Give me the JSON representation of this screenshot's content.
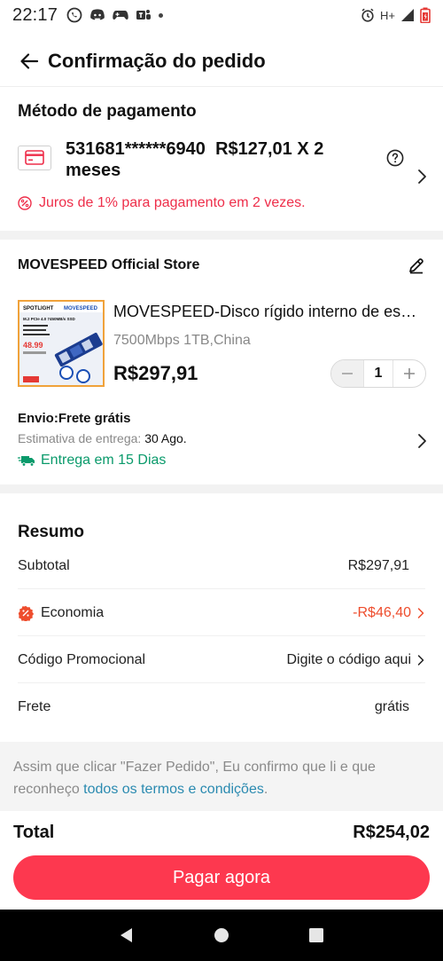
{
  "status_bar": {
    "time": "22:17",
    "network": "H+",
    "left_icons": [
      "whatsapp-icon",
      "discord-icon",
      "game-controller-icon",
      "teams-icon"
    ],
    "right_icons": [
      "alarm-icon",
      "signal-icon",
      "battery-icon"
    ]
  },
  "header": {
    "title": "Confirmação do pedido",
    "back_icon": "arrow-left-icon"
  },
  "payment": {
    "section_title": "Método de pagamento",
    "card_masked": "531681******6940",
    "installment": "R$127,01 X 2 meses",
    "interest_note": "Juros de 1% para pagamento em 2 vezes."
  },
  "store": {
    "name": "MOVESPEED Official Store"
  },
  "product": {
    "title": "MOVESPEED-Disco rígido interno de es…",
    "variant": "7500Mbps 1TB,China",
    "price": "R$297,91",
    "quantity": "1",
    "thumb_brand_left": "SPOTLIGHT",
    "thumb_brand_right": "MOVESPEED",
    "thumb_heading": "M.2 PCIe 4.0 7450MB/s SSD",
    "thumb_price": "48.99"
  },
  "shipping": {
    "label": "Envio:Frete grátis",
    "estimate_label": "Estimativa de entrega:",
    "estimate_date": "30 Ago.",
    "delivery_days": "Entrega em 15 Dias"
  },
  "summary": {
    "title": "Resumo",
    "subtotal_label": "Subtotal",
    "subtotal_value": "R$297,91",
    "economy_label": "Economia",
    "economy_value": "-R$46,40",
    "promo_label": "Código Promocional",
    "promo_value": "Digite o código aqui",
    "shipping_label": "Frete",
    "shipping_value": "grátis"
  },
  "terms": {
    "text": "Assim que clicar \"Fazer Pedido\", Eu confirmo que li e que reconheço ",
    "link": "todos os termos e condições",
    "end": "."
  },
  "footer": {
    "total_label": "Total",
    "total_value": "R$254,02",
    "pay_button": "Pagar agora"
  },
  "colors": {
    "accent": "#fd384f",
    "alert_red": "#ee2e4a",
    "economy_red": "#ee4d2d",
    "delivery_green": "#0a9a6b",
    "link_blue": "#2a8ab0"
  }
}
